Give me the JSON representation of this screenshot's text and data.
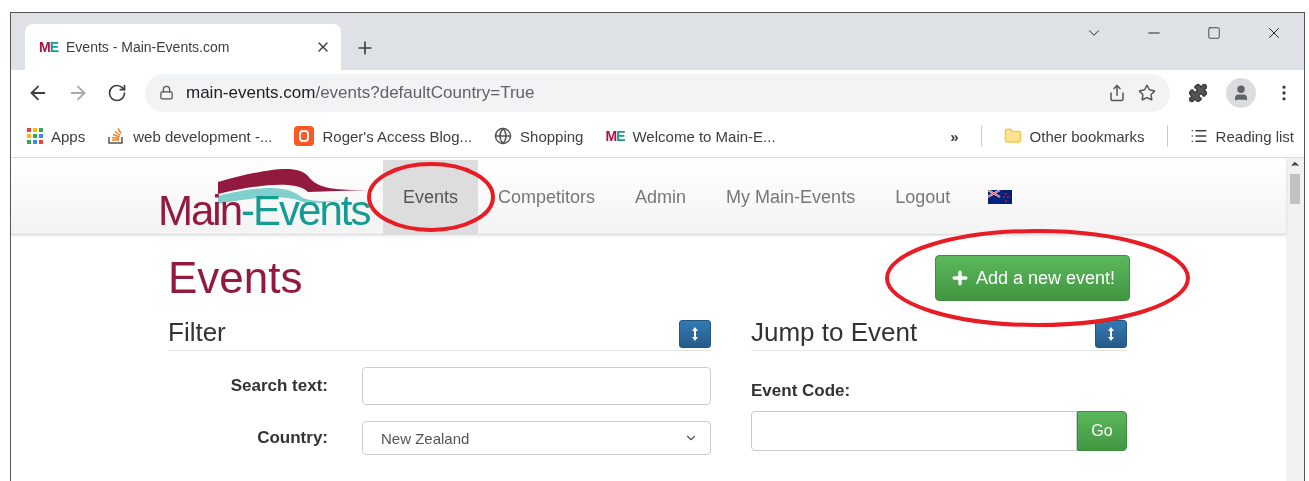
{
  "browser": {
    "tab": {
      "favicon": "ME",
      "title": "Events - Main-Events.com",
      "selected": true
    },
    "address": {
      "host": "main-events.com",
      "path": "/events?defaultCountry=True"
    },
    "bookmarks": [
      {
        "kind": "apps",
        "label": "Apps"
      },
      {
        "kind": "stack",
        "label": "web development -..."
      },
      {
        "kind": "blog",
        "label": "Roger's Access Blog..."
      },
      {
        "kind": "globe",
        "label": "Shopping"
      },
      {
        "kind": "me",
        "favicon": "ME",
        "label": "Welcome to Main-E..."
      }
    ],
    "overflow": "»",
    "other_bookmarks": "Other bookmarks",
    "reading_list": "Reading list"
  },
  "site": {
    "logo": [
      "Main",
      "-Events"
    ],
    "nav": [
      {
        "label": "Events",
        "selected": true,
        "circled": true
      },
      {
        "label": "Competitors",
        "selected": false,
        "circled": false
      },
      {
        "label": "Admin",
        "selected": false,
        "circled": false
      },
      {
        "label": "My Main-Events",
        "selected": false,
        "circled": false
      },
      {
        "label": "Logout",
        "selected": false,
        "circled": false
      }
    ]
  },
  "page": {
    "title": "Events",
    "add_button": {
      "label": "Add a new event!",
      "circled": true
    },
    "filter": {
      "title": "Filter",
      "fields": [
        {
          "kind": "text",
          "label": "Search text:"
        },
        {
          "kind": "select",
          "label": "Country:",
          "value": "New Zealand"
        }
      ]
    },
    "jump": {
      "title": "Jump to Event",
      "label": "Event Code:",
      "button": "Go"
    }
  }
}
